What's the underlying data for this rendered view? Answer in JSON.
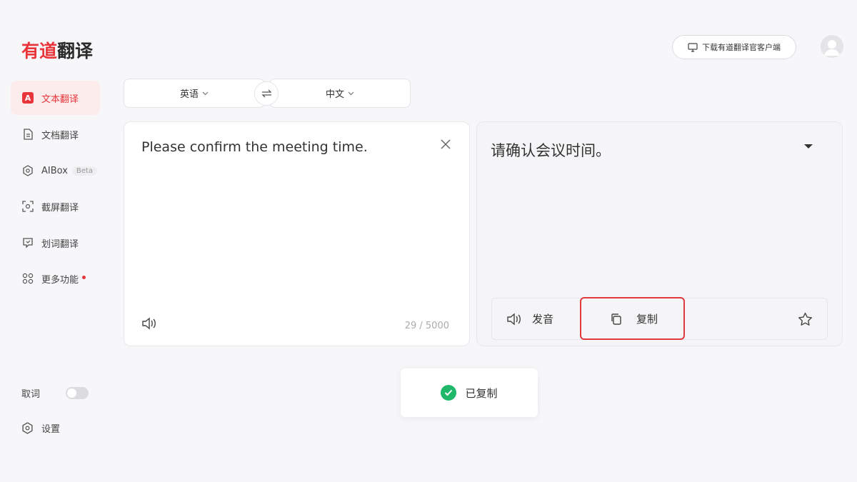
{
  "app": {
    "logo_part1": "有道",
    "logo_part2": "翻译"
  },
  "sidebar": {
    "items": [
      {
        "label": "文本翻译",
        "icon": "text-translate-icon",
        "active": true
      },
      {
        "label": "文档翻译",
        "icon": "document-icon"
      },
      {
        "label": "AIBox",
        "icon": "aibox-icon",
        "badge": "Beta"
      },
      {
        "label": "截屏翻译",
        "icon": "screenshot-icon"
      },
      {
        "label": "划词翻译",
        "icon": "word-select-icon"
      },
      {
        "label": "更多功能",
        "icon": "grid-icon",
        "dot": true
      }
    ],
    "text_translate_glyph": "A",
    "word_pick_label": "取词",
    "settings_label": "设置"
  },
  "header": {
    "download_label": "下载有道翻译官客户端"
  },
  "lang": {
    "source": "英语",
    "target": "中文"
  },
  "source_panel": {
    "text": "Please confirm the meeting time.",
    "counter": "29 / 5000"
  },
  "target_panel": {
    "text": "请确认会议时间。",
    "speak_label": "发音",
    "copy_label": "复制"
  },
  "toast": {
    "message": "已复制"
  },
  "colors": {
    "brand_red": "#e8353a",
    "success_green": "#1fb86a"
  }
}
